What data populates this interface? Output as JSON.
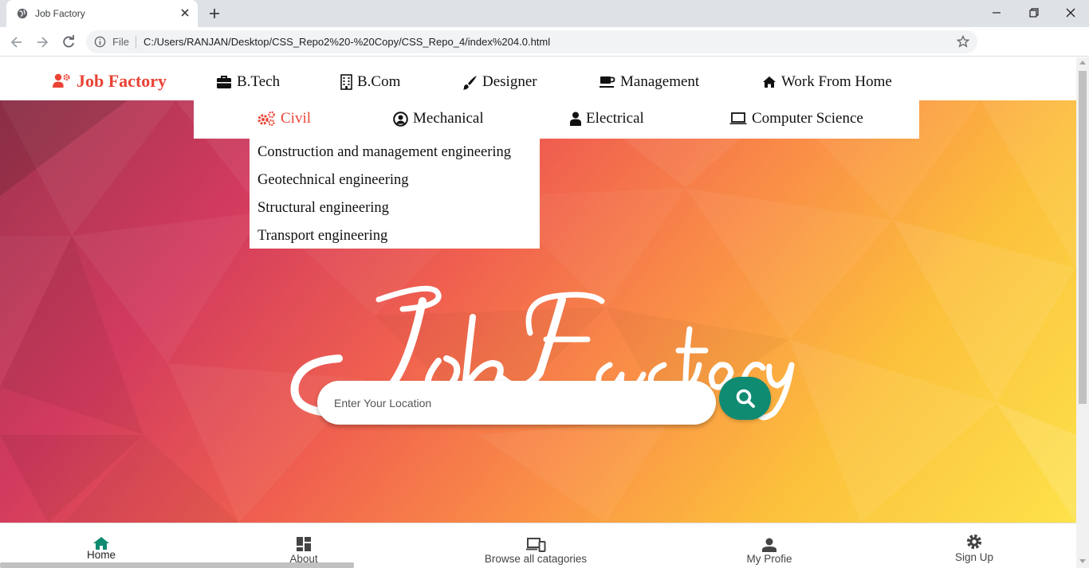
{
  "browser": {
    "tab_title": "Job Factory",
    "file_label": "File",
    "url": "C:/Users/RANJAN/Desktop/CSS_Repo2%20-%20Copy/CSS_Repo_4/index%204.0.html"
  },
  "navbar": {
    "brand": "Job Factory",
    "items": [
      {
        "label": "B.Tech",
        "icon": "briefcase-icon"
      },
      {
        "label": "B.Com",
        "icon": "building-icon"
      },
      {
        "label": "Designer",
        "icon": "paintbrush-icon"
      },
      {
        "label": "Management",
        "icon": "coffee-icon"
      },
      {
        "label": "Work From Home",
        "icon": "home-icon"
      }
    ]
  },
  "subnav": {
    "items": [
      {
        "label": "Civil",
        "icon": "cogs-icon",
        "active": true
      },
      {
        "label": "Mechanical",
        "icon": "user-circle-icon"
      },
      {
        "label": "Electrical",
        "icon": "user-icon"
      },
      {
        "label": "Computer Science",
        "icon": "laptop-icon"
      }
    ]
  },
  "dropdown": {
    "items": [
      "Construction and management engineering",
      "Geotechnical engineering",
      "Structural engineering",
      "Transport engineering"
    ]
  },
  "hero": {
    "logo_text": "Job Factory",
    "search_placeholder": "Enter Your Location"
  },
  "bottom_nav": {
    "items": [
      {
        "label": "Home",
        "icon": "home-icon",
        "active": true
      },
      {
        "label": "About",
        "icon": "dashboard-icon"
      },
      {
        "label": "Browse all catagories",
        "icon": "devices-icon"
      },
      {
        "label": "My Profie",
        "icon": "person-icon"
      },
      {
        "label": "Sign Up",
        "icon": "settings-icon"
      }
    ]
  },
  "colors": {
    "brand_red": "#ea4335",
    "search_green": "#0f8b72",
    "active_home_green": "#0f8b72"
  }
}
